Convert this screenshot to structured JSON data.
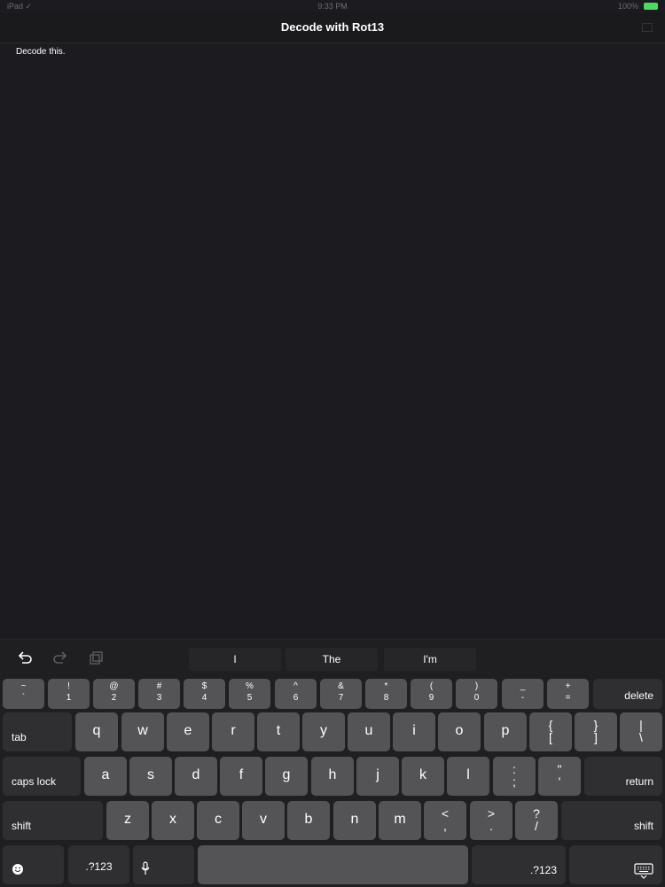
{
  "status_bar": {
    "carrier": "iPad ✓",
    "time": "9:33 PM",
    "battery": "100%"
  },
  "nav": {
    "title": "Decode with Rot13"
  },
  "editor": {
    "text": "Decode this."
  },
  "shortcuts": {
    "undo_icon": "undo-icon",
    "redo_icon": "redo-icon",
    "paste_icon": "paste-icon"
  },
  "suggestions": [
    "I",
    "The",
    "I'm"
  ],
  "keyboard": {
    "row1": [
      {
        "top": "~",
        "bot": "`"
      },
      {
        "top": "!",
        "bot": "1"
      },
      {
        "top": "@",
        "bot": "2"
      },
      {
        "top": "#",
        "bot": "3"
      },
      {
        "top": "$",
        "bot": "4"
      },
      {
        "top": "%",
        "bot": "5"
      },
      {
        "top": "^",
        "bot": "6"
      },
      {
        "top": "&",
        "bot": "7"
      },
      {
        "top": "*",
        "bot": "8"
      },
      {
        "top": "(",
        "bot": "9"
      },
      {
        "top": ")",
        "bot": "0"
      },
      {
        "top": "_",
        "bot": "-"
      },
      {
        "top": "+",
        "bot": "="
      }
    ],
    "delete": "delete",
    "tab": "tab",
    "row2": [
      "q",
      "w",
      "e",
      "r",
      "t",
      "y",
      "u",
      "i",
      "o",
      "p"
    ],
    "row2_sym": [
      {
        "top": "{",
        "bot": "["
      },
      {
        "top": "}",
        "bot": "]"
      },
      {
        "top": "|",
        "bot": "\\"
      }
    ],
    "caps": "caps lock",
    "row3": [
      "a",
      "s",
      "d",
      "f",
      "g",
      "h",
      "j",
      "k",
      "l"
    ],
    "row3_sym": [
      {
        "top": ":",
        "bot": ";"
      },
      {
        "top": "\"",
        "bot": "'"
      }
    ],
    "return": "return",
    "shift_left": "shift",
    "row4": [
      "z",
      "x",
      "c",
      "v",
      "b",
      "n",
      "m"
    ],
    "row4_sym": [
      {
        "top": "<",
        "bot": ","
      },
      {
        "top": ">",
        "bot": "."
      },
      {
        "top": "?",
        "bot": "/"
      }
    ],
    "shift_right": "shift",
    "numbers_left": ".?123",
    "numbers_right": ".?123",
    "emoji_icon": "emoji-icon",
    "mic_icon": "microphone-icon",
    "dismiss_icon": "keyboard-dismiss-icon"
  }
}
